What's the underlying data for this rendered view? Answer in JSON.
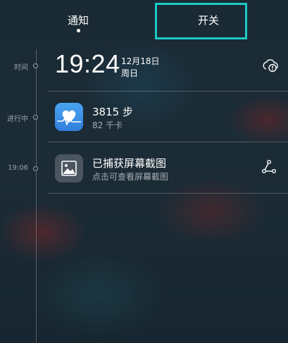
{
  "tabs": {
    "notify": "通知",
    "switch": "开关"
  },
  "timeline": {
    "time_label": "时间",
    "progress_label": "进行中",
    "shot_time": "19:06"
  },
  "clock": {
    "time": "19:24",
    "date": "12月18日",
    "weekday": "周日"
  },
  "steps": {
    "title": "3815 步",
    "subtitle": "82 千卡"
  },
  "screenshot": {
    "title": "已捕获屏幕截图",
    "subtitle": "点击可查看屏幕截图"
  },
  "colors": {
    "highlight": "#1ec9c4",
    "health_icon": "#3a8ee6"
  }
}
